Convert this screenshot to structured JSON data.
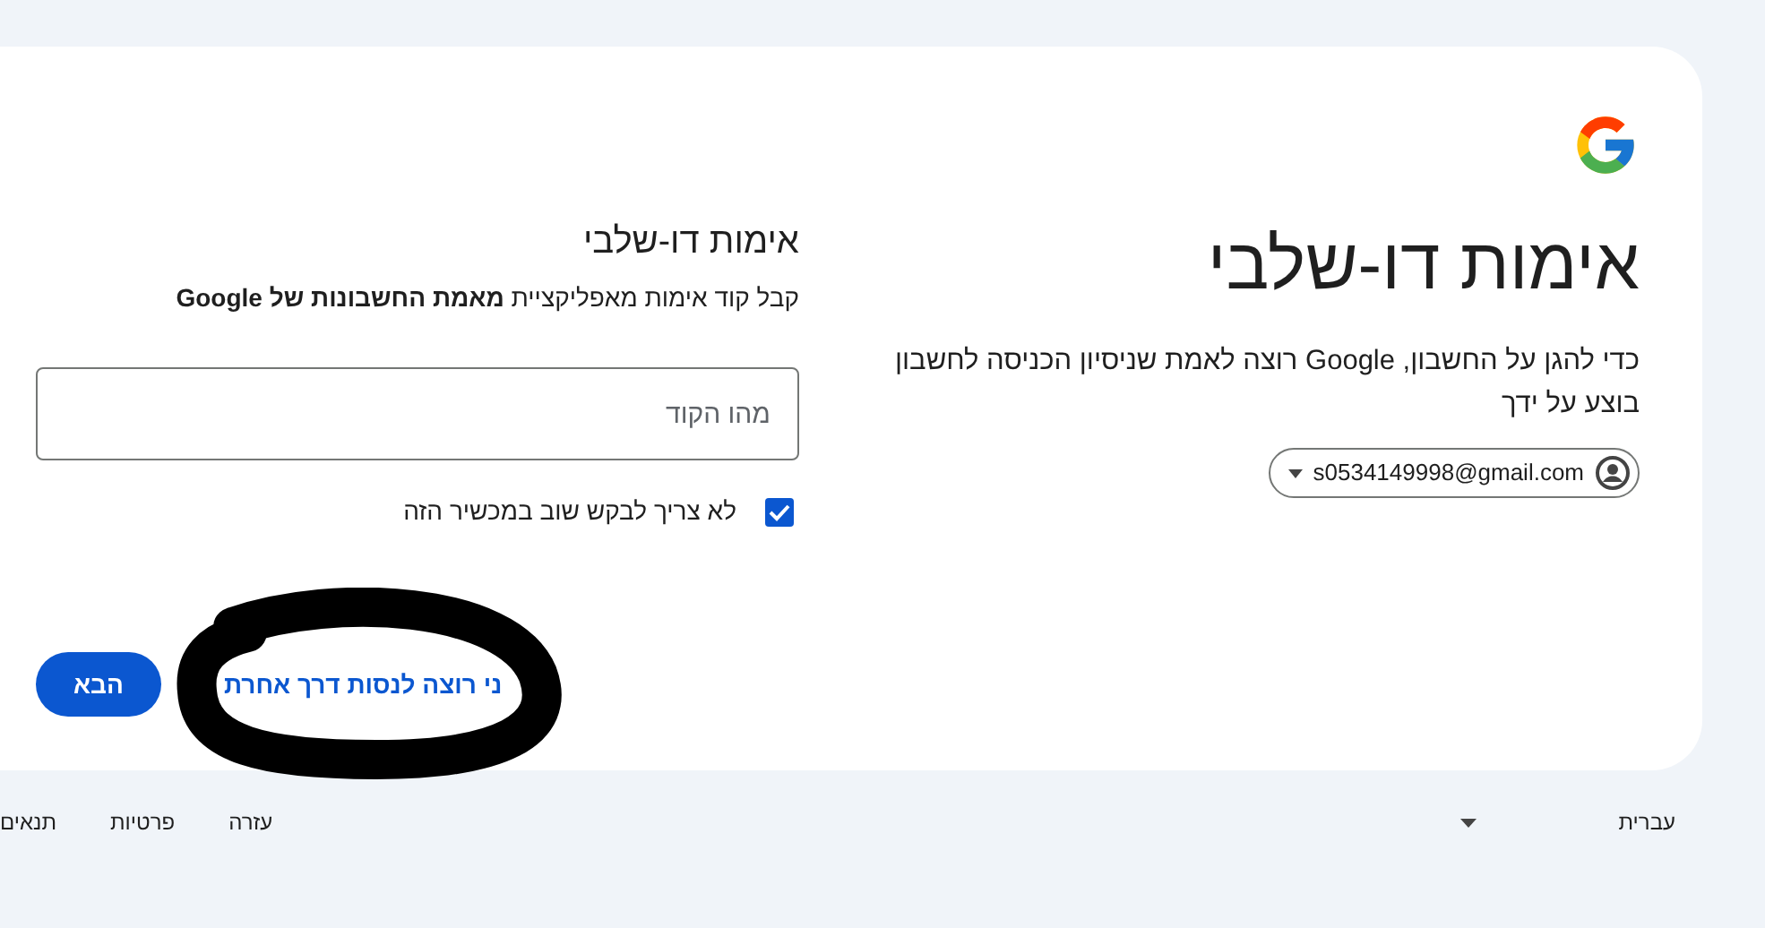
{
  "header": {
    "title": "אימות דו-שלבי",
    "description": "כדי להגן על החשבון, Google רוצה לאמת שניסיון הכניסה לחשבון בוצע על ידך",
    "account": "s0534149998@gmail.com"
  },
  "form": {
    "title": "אימות דו-שלבי",
    "instructions": "קבל קוד אימות מאפליקציית **מאמת החשבונות של Google**",
    "code_field": {
      "placeholder": "מהו הקוד"
    },
    "remember_device": {
      "label": "לא צריך לבקש שוב במכשיר הזה",
      "checked": true
    },
    "next_button": "הבא",
    "alternative_link": "ני רוצה לנסות דרך אחרת"
  },
  "footer": {
    "language": "עברית",
    "links": [
      "עזרה",
      "פרטיות",
      "תנאים"
    ]
  }
}
